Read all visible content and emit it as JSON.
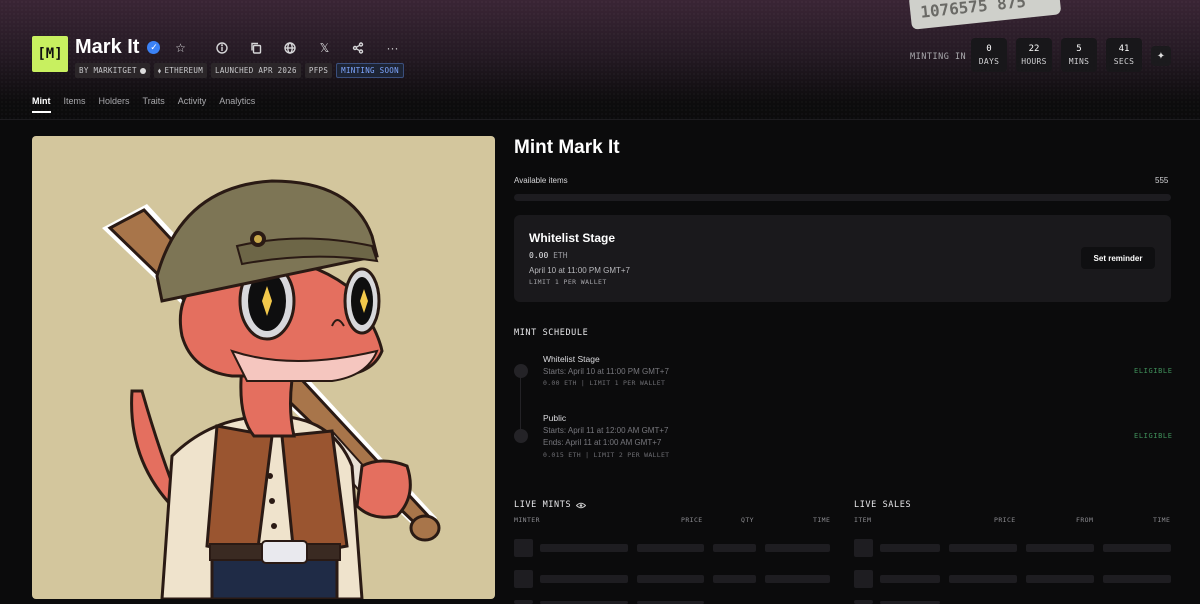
{
  "header": {
    "logo_text": "[M]",
    "title": "Mark It",
    "chips": {
      "by": "BY MARKITGET",
      "chain": "ETHEREUM",
      "launched": "LAUNCHED APR 2026",
      "category": "PFPS",
      "status": "MINTING SOON"
    },
    "hero_card_text": "1076575 875"
  },
  "countdown": {
    "label": "MINTING IN",
    "days": {
      "value": "0",
      "unit": "DAYS"
    },
    "hours": {
      "value": "22",
      "unit": "HOURS"
    },
    "mins": {
      "value": "5",
      "unit": "MINS"
    },
    "secs": {
      "value": "41",
      "unit": "SECS"
    }
  },
  "tabs": [
    "Mint",
    "Items",
    "Holders",
    "Traits",
    "Activity",
    "Analytics"
  ],
  "mint": {
    "title": "Mint Mark It",
    "available_label": "Available items",
    "available_count": "555",
    "stage": {
      "name": "Whitelist Stage",
      "price": "0.00",
      "unit": "ETH",
      "date": "April 10 at 11:00 PM GMT+7",
      "limit": "LIMIT 1 PER WALLET",
      "button": "Set reminder"
    }
  },
  "schedule": {
    "heading": "MINT SCHEDULE",
    "stages": [
      {
        "name": "Whitelist Stage",
        "starts": "Starts: April 10 at 11:00 PM GMT+7",
        "ends": "",
        "meta": "0.00 ETH | LIMIT 1 PER WALLET",
        "status": "ELIGIBLE"
      },
      {
        "name": "Public",
        "starts": "Starts: April 11 at 12:00 AM GMT+7",
        "ends": "Ends: April 11 at 1:00 AM GMT+7",
        "meta": "0.015 ETH | LIMIT 2 PER WALLET",
        "status": "ELIGIBLE"
      }
    ]
  },
  "live_mints": {
    "heading": "LIVE MINTS",
    "columns": [
      "MINTER",
      "PRICE",
      "QTY",
      "TIME"
    ]
  },
  "live_sales": {
    "heading": "LIVE SALES",
    "columns": [
      "ITEM",
      "PRICE",
      "FROM",
      "TIME"
    ]
  },
  "colors": {
    "accent_logo": "#c8f060",
    "verified": "#3b82f6",
    "eligible": "#3f8f5a",
    "artwork_bg": "#d3c69d"
  },
  "icons": [
    "verified-badge-icon",
    "star-icon",
    "info-icon",
    "copy-icon",
    "globe-icon",
    "x-icon",
    "share-icon",
    "more-icon",
    "sparkle-icon",
    "eye-icon"
  ]
}
